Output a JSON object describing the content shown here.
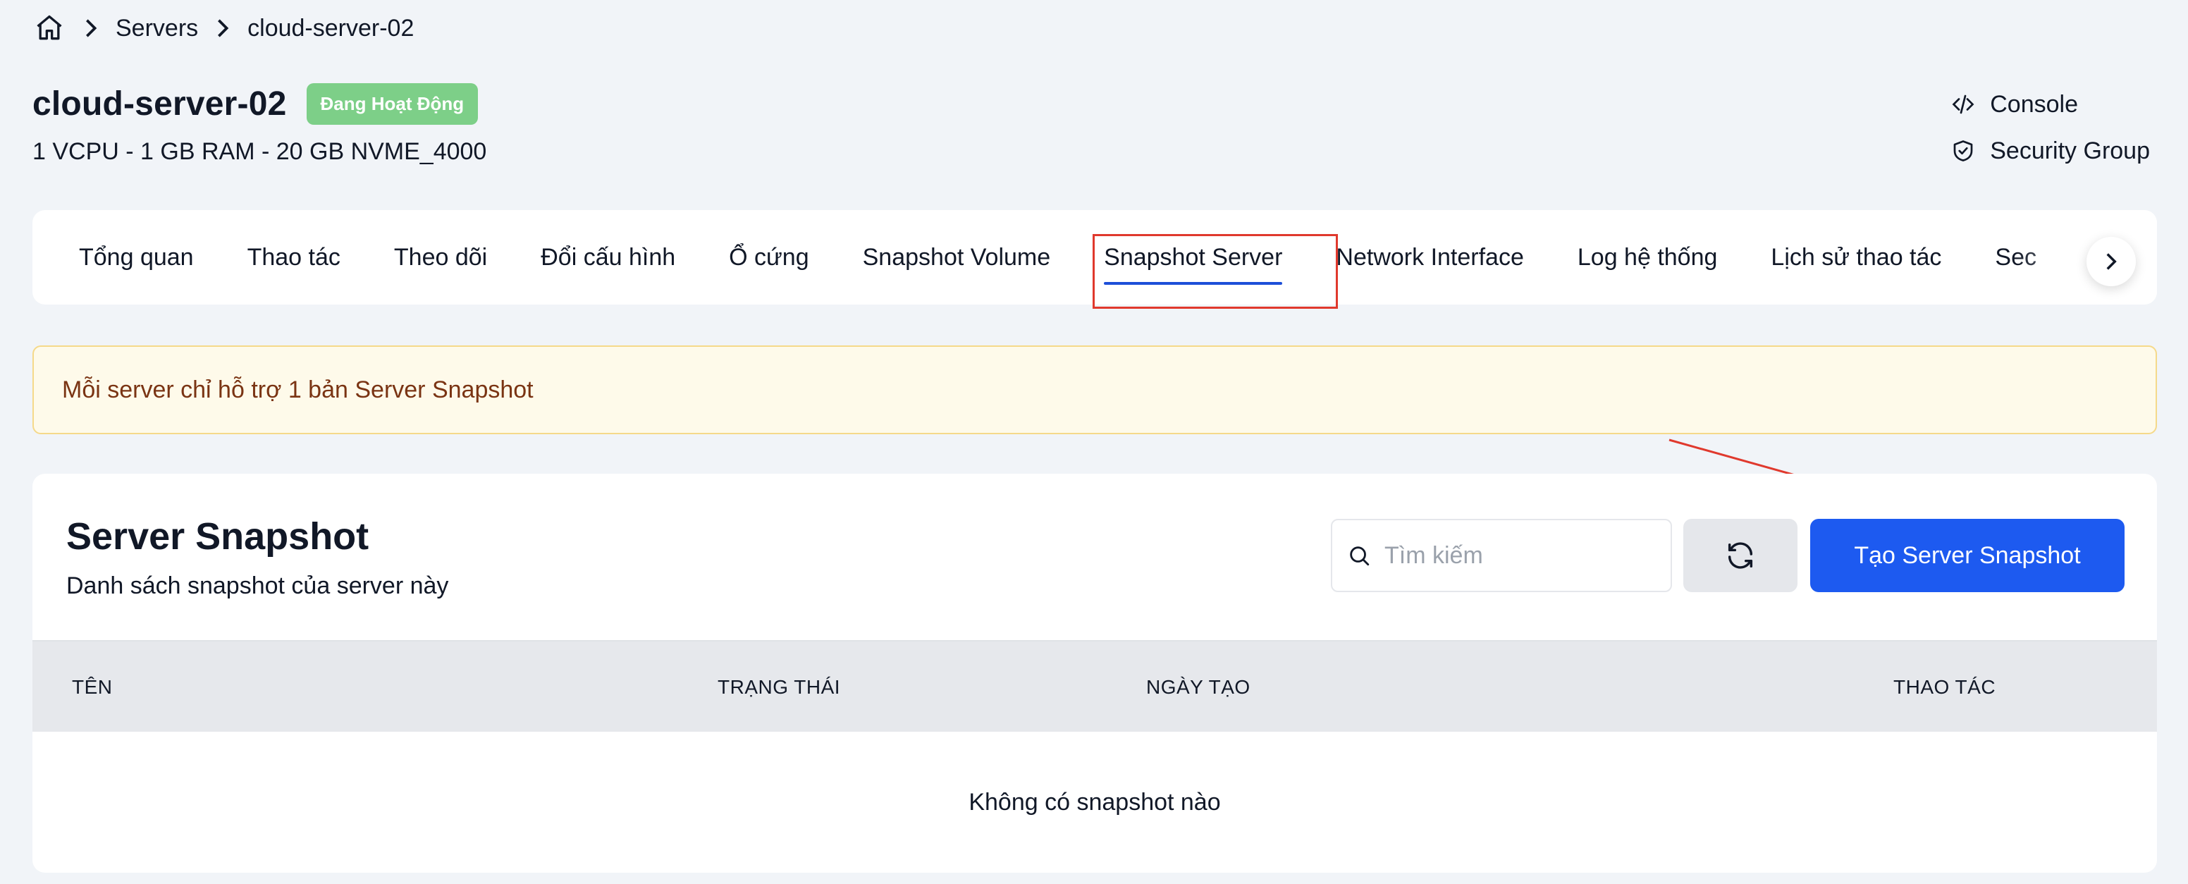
{
  "breadcrumb": {
    "home_icon": "home-icon",
    "items": [
      "Servers",
      "cloud-server-02"
    ]
  },
  "header": {
    "title": "cloud-server-02",
    "status": "Đang Hoạt Động",
    "status_color": "#7dcf88",
    "specs": "1 VCPU - 1 GB RAM - 20 GB NVME_4000",
    "actions": [
      {
        "label": "Console",
        "icon": "code-icon"
      },
      {
        "label": "Security Group",
        "icon": "shield-check-icon"
      }
    ]
  },
  "tabs": {
    "items": [
      "Tổng quan",
      "Thao tác",
      "Theo dõi",
      "Đổi cấu hình",
      "Ổ cứng",
      "Snapshot Volume",
      "Snapshot Server",
      "Network Interface",
      "Log hệ thống",
      "Lịch sử thao tác",
      "Sec"
    ],
    "active": "Snapshot Server",
    "accent": "#1d4fd8"
  },
  "alert": {
    "text": "Mỗi server chỉ hỗ trợ 1 bản Server Snapshot"
  },
  "snapshot": {
    "title": "Server Snapshot",
    "subtitle": "Danh sách snapshot của server này",
    "search_placeholder": "Tìm kiếm",
    "create_label": "Tạo Server Snapshot",
    "create_color": "#1d5af0",
    "columns": [
      "TÊN",
      "TRẠNG THÁI",
      "NGÀY TẠO",
      "THAO TÁC"
    ],
    "empty_text": "Không có snapshot nào"
  }
}
